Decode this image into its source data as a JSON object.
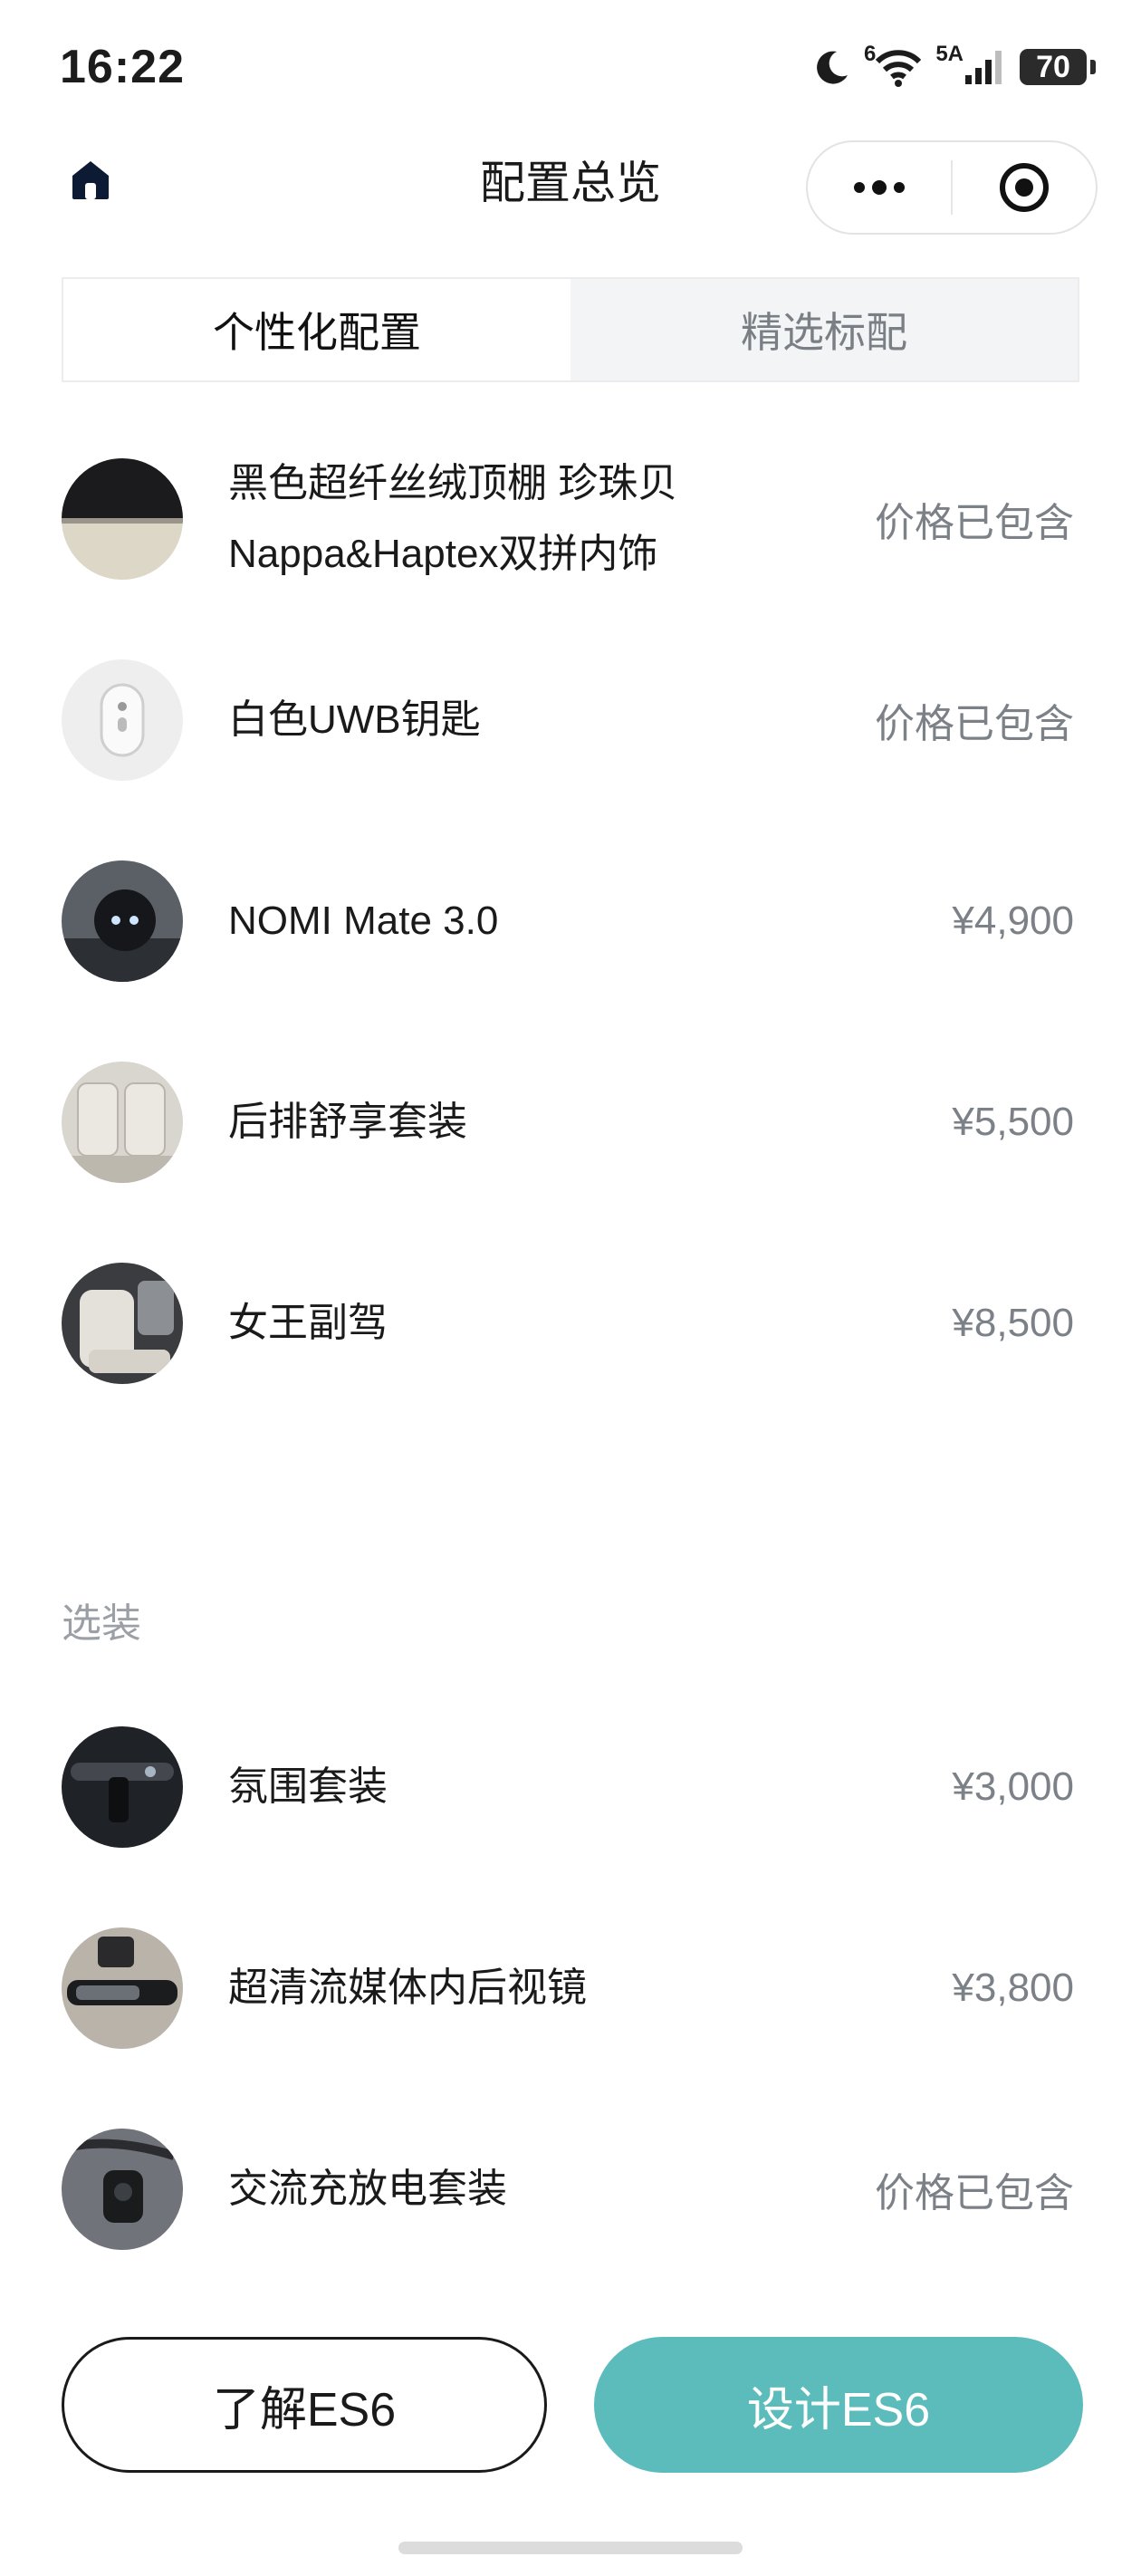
{
  "status_bar": {
    "time": "16:22",
    "network_label": "6",
    "signal_label": "5A",
    "battery": "70"
  },
  "nav": {
    "title": "配置总览",
    "home_icon": "home-icon",
    "more_icon": "more-dots-icon",
    "close_icon": "target-circle-icon"
  },
  "tabs": [
    {
      "label": "个性化配置",
      "active": true
    },
    {
      "label": "精选标配",
      "active": false
    }
  ],
  "items": [
    {
      "name": "黑色超纤丝绒顶棚 珍珠贝Nappa&Haptex双拼内饰",
      "price": "价格已包含",
      "thumb": "headliner-swatch"
    },
    {
      "name": "白色UWB钥匙",
      "price": "价格已包含",
      "thumb": "uwb-key"
    },
    {
      "name": "NOMI Mate 3.0",
      "price": "¥4,900",
      "thumb": "nomi-robot"
    },
    {
      "name": "后排舒享套装",
      "price": "¥5,500",
      "thumb": "rear-seat"
    },
    {
      "name": "女王副驾",
      "price": "¥8,500",
      "thumb": "passenger-seat"
    }
  ],
  "optional_section": {
    "label": "选装",
    "items": [
      {
        "name": "氛围套装",
        "price": "¥3,000",
        "thumb": "ambience-kit"
      },
      {
        "name": "超清流媒体内后视镜",
        "price": "¥3,800",
        "thumb": "rearview-mirror"
      },
      {
        "name": "交流充放电套装",
        "price": "价格已包含",
        "thumb": "charging-kit"
      }
    ]
  },
  "buttons": {
    "learn": "了解ES6",
    "design": "设计ES6"
  },
  "colors": {
    "accent": "#5cbcbc",
    "price_gray": "#7b8187",
    "tab_inactive_bg": "#f3f4f5"
  }
}
